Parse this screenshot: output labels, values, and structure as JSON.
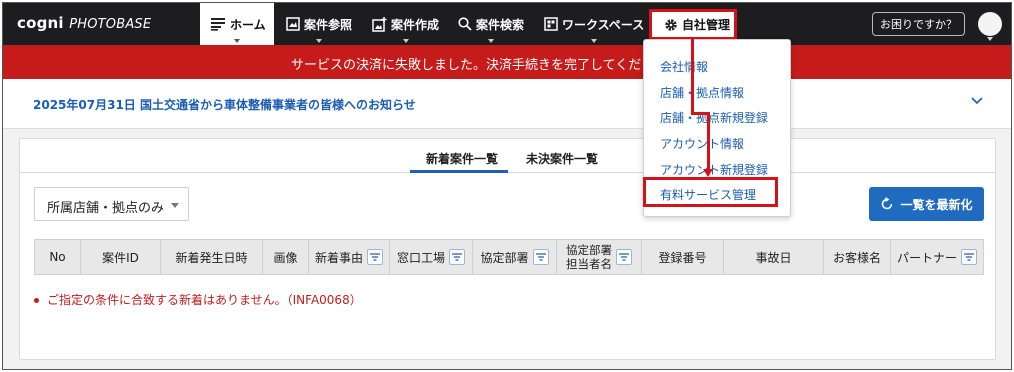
{
  "app": {
    "logo_main": "cogni",
    "logo_sub": "PHOTOBASE"
  },
  "nav": {
    "home": "ホーム",
    "view": "案件参照",
    "create": "案件作成",
    "search": "案件検索",
    "workspace": "ワークスペース",
    "company": "自社管理",
    "help": "お困りですか？"
  },
  "banner": {
    "text": "サービスの決済に失敗しました。決済手続きを完了してください。"
  },
  "notice": {
    "text": "2025年07月31日  国土交通省から車体整備事業者の皆様へのお知らせ"
  },
  "tabs": {
    "new_list": "新着案件一覧",
    "pending_list": "未決案件一覧"
  },
  "filter": {
    "selected": "所属店舗・拠点のみ"
  },
  "refresh": {
    "label": "一覧を最新化"
  },
  "table": {
    "headers": {
      "no": "No",
      "case_id": "案件ID",
      "date": "新着発生日時",
      "image": "画像",
      "reason": "新着事由",
      "factory": "窓口工場",
      "dept": "協定部署",
      "dept_person_1": "協定部署",
      "dept_person_2": "担当者名",
      "reg_no": "登録番号",
      "accident_date": "事故日",
      "customer": "お客様名",
      "partner": "パートナー"
    },
    "empty_message": "ご指定の条件に合致する新着はありません。（INFA0068）"
  },
  "company_menu": {
    "items": [
      "会社情報",
      "店舗・拠点情報",
      "店舗・拠点新規登録",
      "アカウント情報",
      "アカウント新規登録",
      "有料サービス管理"
    ]
  },
  "colors": {
    "navbar": "#1d1d1f",
    "banner": "#c51b1b",
    "accent_blue": "#1f6bbf",
    "highlight_red": "#d4121a"
  }
}
